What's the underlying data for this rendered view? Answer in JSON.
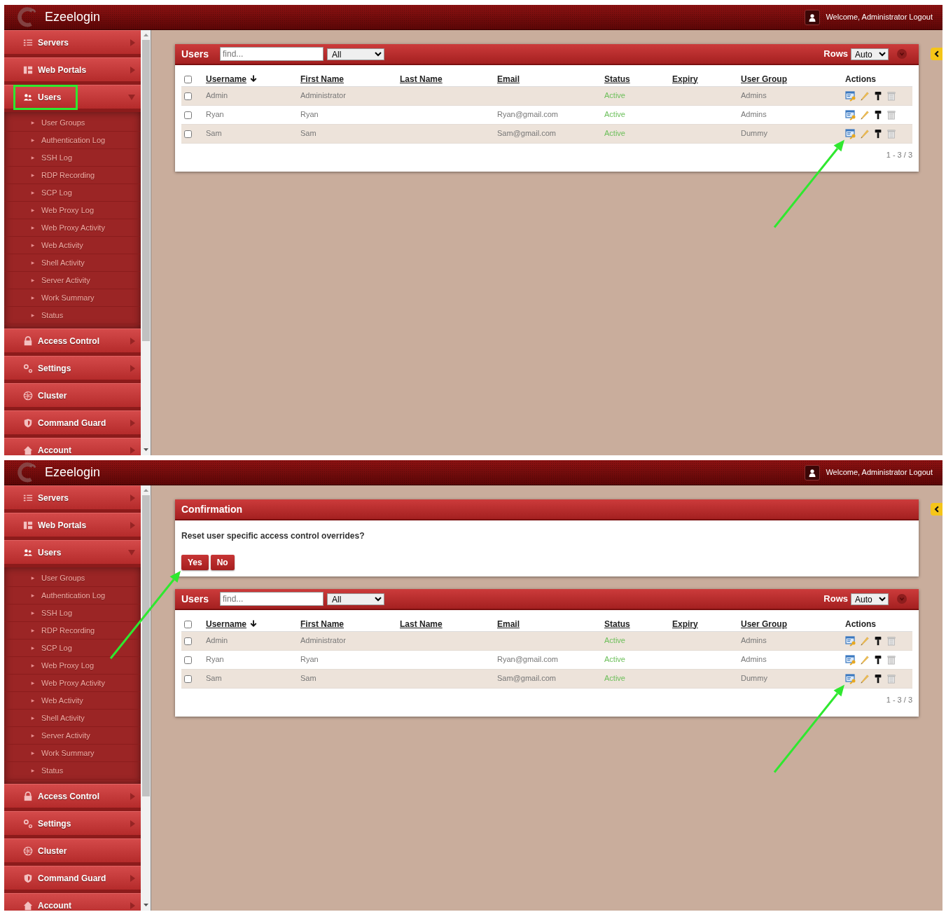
{
  "screens": [
    {
      "header": {
        "brand": "Ezeelogin",
        "welcome": "Welcome, Administrator",
        "logout": "Logout"
      },
      "sidebar": [
        {
          "label": "Servers",
          "has_submenu": true,
          "expanded": false,
          "highlighted": false
        },
        {
          "label": "Web Portals",
          "has_submenu": true,
          "expanded": false,
          "highlighted": false
        },
        {
          "label": "Users",
          "has_submenu": true,
          "expanded": true,
          "highlighted": true,
          "children": [
            {
              "label": "User Groups"
            },
            {
              "label": "Authentication Log"
            },
            {
              "label": "SSH Log"
            },
            {
              "label": "RDP Recording"
            },
            {
              "label": "SCP Log"
            },
            {
              "label": "Web Proxy Log"
            },
            {
              "label": "Web Proxy Activity"
            },
            {
              "label": "Web Activity"
            },
            {
              "label": "Shell Activity"
            },
            {
              "label": "Server Activity"
            },
            {
              "label": "Work Summary"
            },
            {
              "label": "Status"
            }
          ]
        },
        {
          "label": "Access Control",
          "has_submenu": true,
          "expanded": false,
          "highlighted": false
        },
        {
          "label": "Settings",
          "has_submenu": true,
          "expanded": false,
          "highlighted": false
        },
        {
          "label": "Cluster",
          "has_submenu": false,
          "highlighted": false
        },
        {
          "label": "Command Guard",
          "has_submenu": true,
          "expanded": false,
          "highlighted": false
        },
        {
          "label": "Account",
          "has_submenu": true,
          "expanded": false,
          "highlighted": false
        }
      ],
      "users_panel": {
        "title": "Users",
        "search": {
          "placeholder": "find..."
        },
        "filter": "All",
        "rows_label": "Rows",
        "rows_value": "Auto",
        "select_all": {
          "checked": false
        },
        "columns": [
          {
            "label": "Username",
            "sortable": true,
            "sorted": true
          },
          {
            "label": "First Name",
            "sortable": true,
            "sorted": false
          },
          {
            "label": "Last Name",
            "sortable": true,
            "sorted": false
          },
          {
            "label": "Email",
            "sortable": true,
            "sorted": false
          },
          {
            "label": "Status",
            "sortable": true,
            "sorted": false
          },
          {
            "label": "Expiry",
            "sortable": true,
            "sorted": false
          },
          {
            "label": "User Group",
            "sortable": true,
            "sorted": false
          },
          {
            "label": "Actions",
            "sortable": false
          }
        ],
        "rows": [
          {
            "checked": false,
            "username": "Admin",
            "first_name": "Administrator",
            "status": "Active",
            "user_group": "Admins"
          },
          {
            "checked": false,
            "username": "Ryan",
            "first_name": "Ryan",
            "email": "Ryan@gmail.com",
            "status": "Active",
            "user_group": "Admins"
          },
          {
            "checked": false,
            "username": "Sam",
            "first_name": "Sam",
            "email": "Sam@gmail.com",
            "status": "Active",
            "user_group": "Dummy",
            "arrow_pointed": true
          }
        ],
        "pagination": "1 - 3 / 3"
      }
    },
    {
      "header": {
        "brand": "Ezeelogin",
        "welcome": "Welcome, Administrator",
        "logout": "Logout"
      },
      "sidebar": [
        {
          "label": "Servers",
          "has_submenu": true,
          "expanded": false,
          "highlighted": false
        },
        {
          "label": "Web Portals",
          "has_submenu": true,
          "expanded": false,
          "highlighted": false
        },
        {
          "label": "Users",
          "has_submenu": true,
          "expanded": true,
          "highlighted": false,
          "children": [
            {
              "label": "User Groups"
            },
            {
              "label": "Authentication Log"
            },
            {
              "label": "SSH Log"
            },
            {
              "label": "RDP Recording"
            },
            {
              "label": "SCP Log"
            },
            {
              "label": "Web Proxy Log"
            },
            {
              "label": "Web Proxy Activity"
            },
            {
              "label": "Web Activity"
            },
            {
              "label": "Shell Activity"
            },
            {
              "label": "Server Activity"
            },
            {
              "label": "Work Summary"
            },
            {
              "label": "Status"
            }
          ]
        },
        {
          "label": "Access Control",
          "has_submenu": true,
          "expanded": false,
          "highlighted": false
        },
        {
          "label": "Settings",
          "has_submenu": true,
          "expanded": false,
          "highlighted": false
        },
        {
          "label": "Cluster",
          "has_submenu": false,
          "highlighted": false
        },
        {
          "label": "Command Guard",
          "has_submenu": true,
          "expanded": false,
          "highlighted": false
        },
        {
          "label": "Account",
          "has_submenu": true,
          "expanded": false,
          "highlighted": false
        }
      ],
      "dialog": {
        "title": "Confirmation",
        "message": "Reset user specific access control overrides?",
        "buttons": [
          "Yes",
          "No"
        ],
        "arrow_pointed": true
      },
      "users_panel": {
        "title": "Users",
        "search": {
          "placeholder": "find..."
        },
        "filter": "All",
        "rows_label": "Rows",
        "rows_value": "Auto",
        "select_all": {
          "checked": false
        },
        "columns": [
          {
            "label": "Username",
            "sortable": true,
            "sorted": true
          },
          {
            "label": "First Name",
            "sortable": true,
            "sorted": false
          },
          {
            "label": "Last Name",
            "sortable": true,
            "sorted": false
          },
          {
            "label": "Email",
            "sortable": true,
            "sorted": false
          },
          {
            "label": "Status",
            "sortable": true,
            "sorted": false
          },
          {
            "label": "Expiry",
            "sortable": true,
            "sorted": false
          },
          {
            "label": "User Group",
            "sortable": true,
            "sorted": false
          },
          {
            "label": "Actions",
            "sortable": false
          }
        ],
        "rows": [
          {
            "checked": false,
            "username": "Admin",
            "first_name": "Administrator",
            "status": "Active",
            "user_group": "Admins"
          },
          {
            "checked": false,
            "username": "Ryan",
            "first_name": "Ryan",
            "email": "Ryan@gmail.com",
            "status": "Active",
            "user_group": "Admins"
          },
          {
            "checked": false,
            "username": "Sam",
            "first_name": "Sam",
            "email": "Sam@gmail.com",
            "status": "Active",
            "user_group": "Dummy",
            "arrow_pointed": true
          }
        ],
        "pagination": "1 - 3 / 3"
      }
    }
  ]
}
